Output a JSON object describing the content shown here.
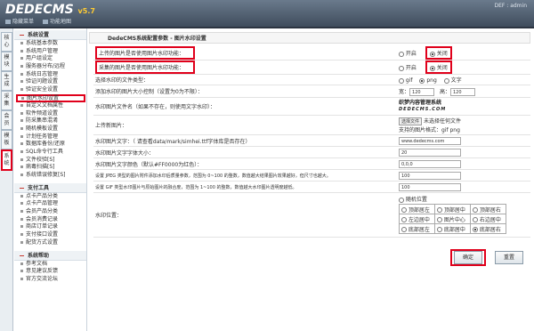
{
  "header": {
    "logo": "DEDECMS",
    "version": "v5.7",
    "links": [
      "隐藏菜单",
      "功能地图"
    ],
    "user": "DEF : admin"
  },
  "left_tabs": [
    "核心",
    "模块",
    "生成",
    "采集",
    "会员",
    "模板",
    "系统"
  ],
  "sidebar": {
    "sections": [
      {
        "title": "系统设置",
        "items": [
          "系统基本参数",
          "系统用户管理",
          "用户组设定",
          "服务器分布/远程",
          "系统日志管理",
          "验证问题设置",
          "验证安全设置",
          "图片水印设置",
          "自定义文档属性",
          "软件频道设置",
          "防采集串混淆",
          "随机模板设置",
          "计划任务管理",
          "数据库备份/还原",
          "SQL命令行工具",
          "文件校验[S]",
          "病毒扫描[S]",
          "系统错误修复[S]"
        ]
      },
      {
        "title": "支付工具",
        "items": [
          "点卡产品分类",
          "点卡产品管理",
          "会员产品分类",
          "会员消费记录",
          "商店订单记录",
          "支付接口设置",
          "配货方式设置"
        ]
      },
      {
        "title": "系统帮助",
        "items": [
          "参考文档",
          "意见建议反馈",
          "官方交流论坛"
        ]
      }
    ],
    "active_item": "图片水印设置"
  },
  "breadcrumb": "DedeCMS系统配置参数 - 图片水印设置",
  "form": {
    "row_upload": {
      "label": "上传的图片是否使用图片水印功能：",
      "opt_on": "开启",
      "opt_off": "关闭"
    },
    "row_collect": {
      "label": "采集的图片是否使用图片水印功能：",
      "opt_on": "开启",
      "opt_off": "关闭"
    },
    "row_type": {
      "label": "选择水印的文件类型：",
      "opts": [
        "gif",
        "png",
        "文字"
      ]
    },
    "row_size": {
      "label": "添加水印的图片大小控制（设置为0为不限）：",
      "width_label": "宽：",
      "width": "120",
      "height_label": "高：",
      "height": "120"
    },
    "row_filename": {
      "label": "水印图片文件名（如果不存在，则使用文字水印）：",
      "logo_line1": "织梦内容管理系统",
      "logo_line2": "DEDECMS.COM"
    },
    "row_upload_img": {
      "label": "上传新图片：",
      "file_button": "选择文件",
      "file_status": "未选择任何文件",
      "formats": "支持的图片格式：gif png"
    },
    "row_text": {
      "label": "水印图片文字：（ 请查看data/mark/simhei.ttf字体库是否存在）",
      "value": "www.dedecms.com"
    },
    "row_fontsize": {
      "label": "水印图片文字字体大小：",
      "value": "20"
    },
    "row_color": {
      "label": "水印图片文字颜色（默认#FF0000为红色）：",
      "value": "0,0,0"
    },
    "row_jpeg": {
      "label": "设置 JPEG 类型的图片附件添加水印后质量参数，范围为 0~100 的整数，数值越大结果图片效果越好，但尺寸也越大。",
      "value": "100"
    },
    "row_gif": {
      "label": "设置 GIF 类型水印图片与原始图片的融合度，范围为 1~100 的整数，数值越大水印图片透明度越低。",
      "value": "100"
    },
    "row_position": {
      "label": "水印位置：",
      "random": "随机位置",
      "grid": [
        [
          "顶部居左",
          "顶部居中",
          "顶部居右"
        ],
        [
          "左边居中",
          "图片中心",
          "右边居中"
        ],
        [
          "底部居左",
          "底部居中",
          "底部居右"
        ]
      ]
    }
  },
  "buttons": {
    "ok": "确定",
    "reset": "重置"
  },
  "colors": {
    "highlight": "#e0001b",
    "header": "#4a5868"
  }
}
